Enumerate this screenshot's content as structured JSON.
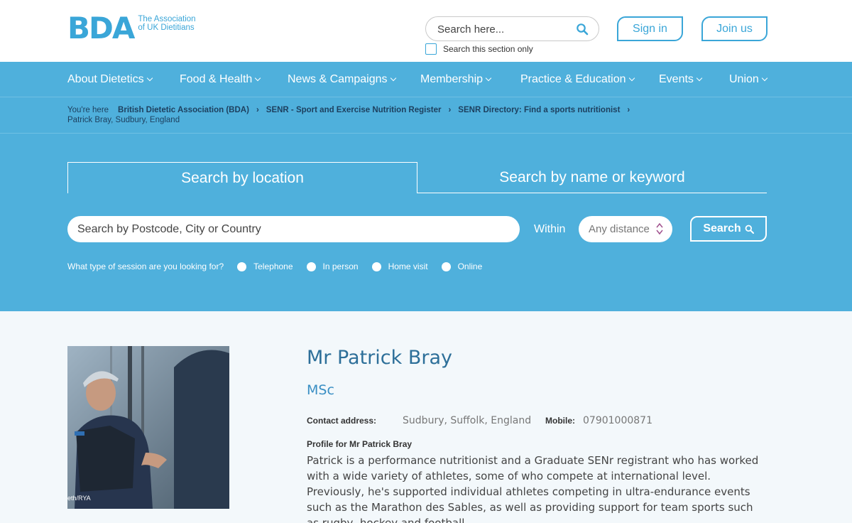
{
  "header": {
    "logo_mark": "BDA",
    "logo_line1": "The Association",
    "logo_line2": "of UK Dietitians",
    "search_placeholder": "Search here...",
    "search_section_only": "Search this section only",
    "sign_in": "Sign in",
    "join_us": "Join us",
    "accent_color": "#3aa6d8"
  },
  "nav": {
    "items": [
      {
        "label": "About Dietetics"
      },
      {
        "label": "Food & Health"
      },
      {
        "label": "News & Campaigns"
      },
      {
        "label": "Membership"
      },
      {
        "label": "Practice & Education"
      },
      {
        "label": "Events"
      },
      {
        "label": "Union"
      }
    ],
    "background": "#4fb0dc"
  },
  "breadcrumb": {
    "prefix": "You're here",
    "items": [
      "British Dietetic Association (BDA)",
      "SENR - Sport and Exercise Nutrition Register",
      "SENR Directory: Find a sports nutritionist"
    ],
    "current": "Patrick Bray, Sudbury, England"
  },
  "search_panel": {
    "tab_location": "Search by location",
    "tab_name": "Search by name or keyword",
    "location_placeholder": "Search by Postcode, City or Country",
    "within_label": "Within",
    "distance_value": "Any distance",
    "search_button": "Search",
    "session_question": "What type of session are you looking for?",
    "session_options": [
      "Telephone",
      "In person",
      "Home visit",
      "Online"
    ]
  },
  "profile": {
    "name": "Mr Patrick Bray",
    "qualification": "MSc",
    "contact_label": "Contact address:",
    "contact_value": "Sudbury, Suffolk, England",
    "mobile_label": "Mobile:",
    "mobile_value": "07901000871",
    "profile_title": "Profile for Mr Patrick Bray",
    "bio": "Patrick is a performance nutritionist and a Graduate SENr registrant who has worked with a wide variety of athletes, some of who compete at international level. Previously, he's supported individual athletes competing in ultra-endurance events such as the Marathon des Sables, as well as providing support for team sports such as rugby, hockey and football.",
    "photo_credit": "eth/RYA"
  }
}
